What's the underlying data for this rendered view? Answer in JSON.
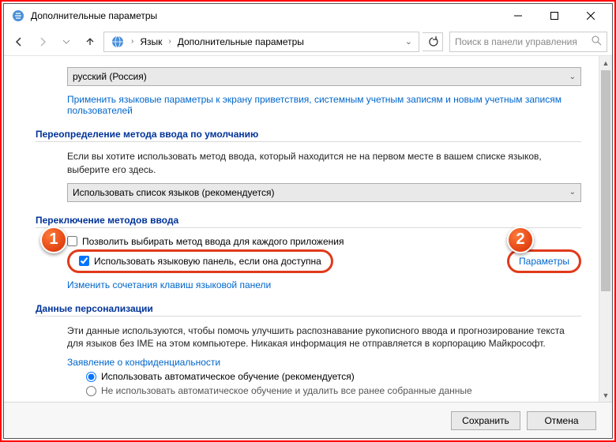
{
  "titlebar": {
    "title": "Дополнительные параметры"
  },
  "breadcrumb": {
    "item1": "Язык",
    "item2": "Дополнительные параметры"
  },
  "search": {
    "placeholder": "Поиск в панели управления"
  },
  "section1": {
    "dropdown": "русский (Россия)",
    "apply_link": "Применить языковые параметры к экрану приветствия, системным учетным записям и новым учетным записям пользователей"
  },
  "section2": {
    "heading": "Переопределение метода ввода по умолчанию",
    "para": "Если вы хотите использовать метод ввода, который находится не на первом месте в вашем списке языков, выберите его здесь.",
    "dropdown": "Использовать список языков (рекомендуется)"
  },
  "section3": {
    "heading": "Переключение методов ввода",
    "check1": "Позволить выбирать метод ввода для каждого приложения",
    "check2": "Использовать языковую панель, если она доступна",
    "params_link": "Параметры",
    "shortcuts_link": "Изменить сочетания клавиш языковой панели"
  },
  "section4": {
    "heading": "Данные персонализации",
    "para": "Эти данные используются, чтобы помочь улучшить распознавание рукописного ввода и прогнозирование текста для языков без IME на этом компьютере. Никакая информация не отправляется в корпорацию Майкрософт.",
    "privacy_link": "Заявление о конфиденциальности",
    "radio1": "Использовать автоматическое обучение (рекомендуется)",
    "radio2": "Не использовать автоматическое обучение и удалить все ранее собранные данные"
  },
  "footer": {
    "save": "Сохранить",
    "cancel": "Отмена"
  },
  "callouts": {
    "one": "1",
    "two": "2"
  }
}
